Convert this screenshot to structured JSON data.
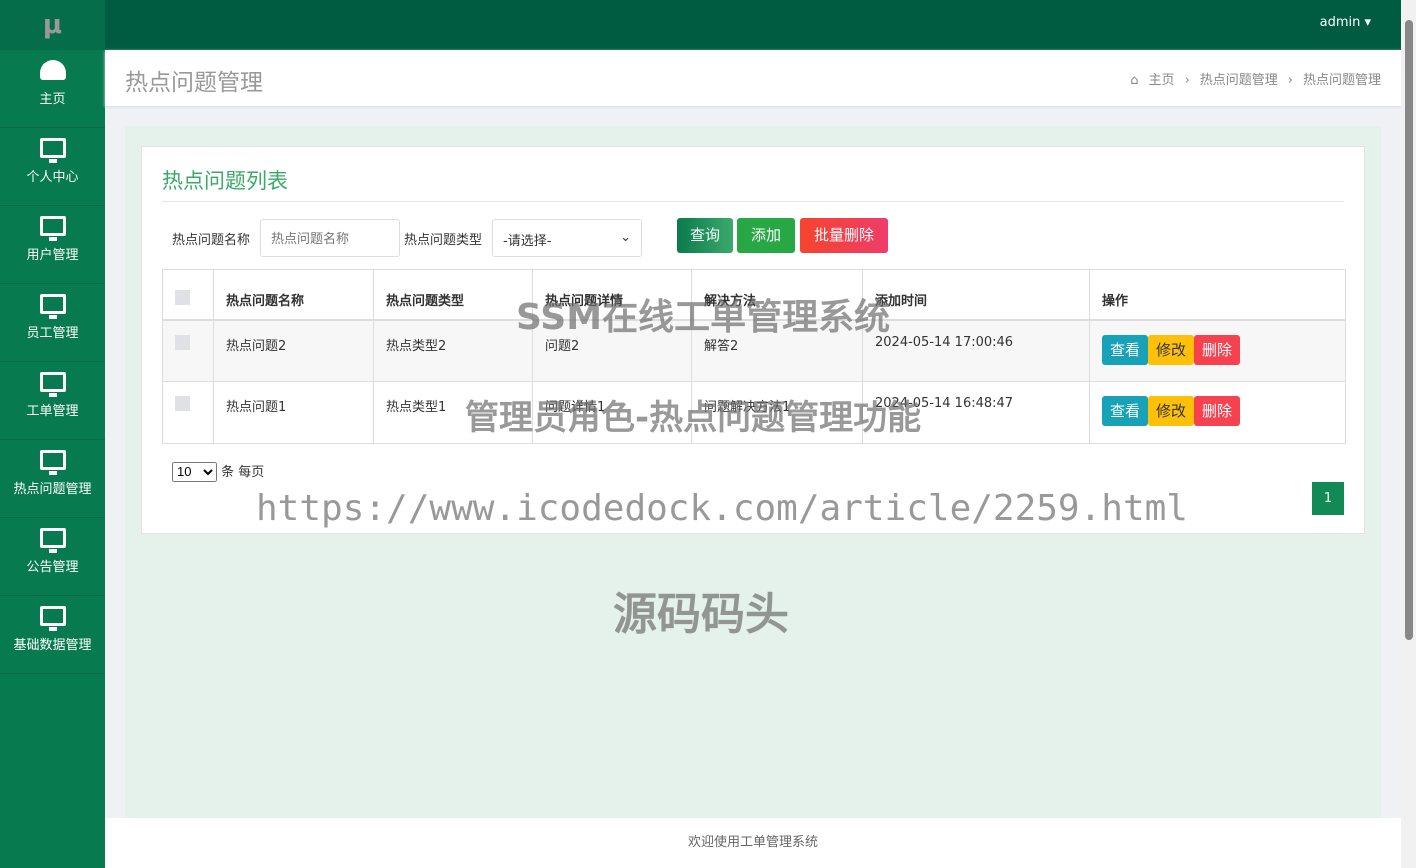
{
  "logo": "μ",
  "sidebar": {
    "items": [
      {
        "label": "主页",
        "icon": "dashboard-icon"
      },
      {
        "label": "个人中心",
        "icon": "monitor-icon"
      },
      {
        "label": "用户管理",
        "icon": "monitor-icon"
      },
      {
        "label": "员工管理",
        "icon": "monitor-icon"
      },
      {
        "label": "工单管理",
        "icon": "monitor-icon"
      },
      {
        "label": "热点问题管理",
        "icon": "monitor-icon"
      },
      {
        "label": "公告管理",
        "icon": "monitor-icon"
      },
      {
        "label": "基础数据管理",
        "icon": "monitor-icon"
      }
    ]
  },
  "topbar": {
    "user": "admin ▾"
  },
  "header": {
    "title": "热点问题管理",
    "breadcrumb": [
      "主页",
      "热点问题管理",
      "热点问题管理"
    ]
  },
  "card": {
    "title": "热点问题列表",
    "search": {
      "name_label": "热点问题名称",
      "name_placeholder": "热点问题名称",
      "type_label": "热点问题类型",
      "type_value": "-请选择-"
    },
    "buttons": {
      "query": "查询",
      "add": "添加",
      "batch_delete": "批量删除"
    },
    "table": {
      "headers": [
        "热点问题名称",
        "热点问题类型",
        "热点问题详情",
        "解决方法",
        "添加时间",
        "操作"
      ],
      "rows": [
        [
          "热点问题2",
          "热点类型2",
          "问题2",
          "解答2",
          "2024-05-14 17:00:46"
        ],
        [
          "热点问题1",
          "热点类型1",
          "问题详情1",
          "问题解决方法1",
          "2024-05-14 16:48:47"
        ]
      ],
      "actions": {
        "view": "查看",
        "edit": "修改",
        "delete": "删除"
      }
    },
    "pagination": {
      "page_size": "10",
      "per_page_label": "条 每页",
      "current_page": "1"
    }
  },
  "footer": "欢迎使用工单管理系统",
  "watermarks": [
    "SSM在线工单管理系统",
    "管理员角色-热点问题管理功能",
    "https://www.icodedock.com/article/2259.html",
    "源码码头"
  ],
  "colors": {
    "primary": "#077a4f",
    "add": "#28a745",
    "danger": "#f5424e",
    "info": "#17a2b8",
    "warning": "#ffc107"
  }
}
